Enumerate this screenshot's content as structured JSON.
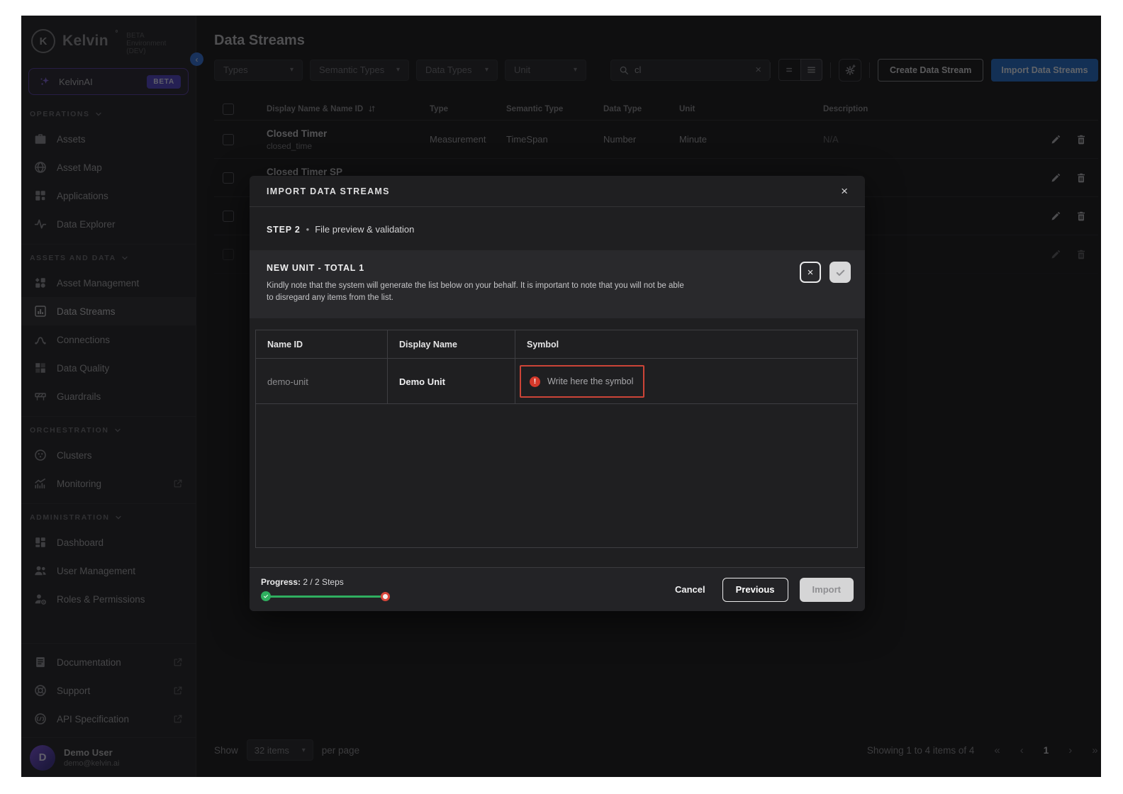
{
  "colors": {
    "accent_blue": "#1f6ac9",
    "accent_purple": "#53399f",
    "success_green": "#2fae5f",
    "error_red": "#cc4437"
  },
  "brand": {
    "name": "Kelvin",
    "env": "BETA Environment (DEV)",
    "logo_letter": "K"
  },
  "sidebar": {
    "ai": {
      "label": "KelvinAI",
      "badge": "BETA",
      "icon": "sparkle-icon"
    },
    "sections": [
      {
        "label": "OPERATIONS",
        "items": [
          {
            "label": "Assets",
            "icon": "briefcase-icon"
          },
          {
            "label": "Asset Map",
            "icon": "globe-icon"
          },
          {
            "label": "Applications",
            "icon": "apps-icon"
          },
          {
            "label": "Data Explorer",
            "icon": "pulse-icon"
          }
        ]
      },
      {
        "label": "ASSETS AND DATA",
        "items": [
          {
            "label": "Asset Management",
            "icon": "asset-management-icon"
          },
          {
            "label": "Data Streams",
            "icon": "bar-chart-icon",
            "active": true
          },
          {
            "label": "Connections",
            "icon": "connections-icon"
          },
          {
            "label": "Data Quality",
            "icon": "data-quality-icon"
          },
          {
            "label": "Guardrails",
            "icon": "guardrail-icon"
          }
        ]
      },
      {
        "label": "ORCHESTRATION",
        "items": [
          {
            "label": "Clusters",
            "icon": "cluster-icon"
          },
          {
            "label": "Monitoring",
            "icon": "monitoring-icon",
            "external": true
          }
        ]
      },
      {
        "label": "ADMINISTRATION",
        "items": [
          {
            "label": "Dashboard",
            "icon": "dashboard-icon"
          },
          {
            "label": "User Management",
            "icon": "users-icon"
          },
          {
            "label": "Roles & Permissions",
            "icon": "roles-icon"
          }
        ]
      }
    ],
    "bottom_items": [
      {
        "label": "Documentation",
        "icon": "document-icon",
        "external": true
      },
      {
        "label": "Support",
        "icon": "support-icon",
        "external": true
      },
      {
        "label": "API Specification",
        "icon": "api-icon",
        "external": true
      }
    ],
    "user": {
      "initial": "D",
      "name": "Demo User",
      "email": "demo@kelvin.ai"
    }
  },
  "page": {
    "title": "Data Streams",
    "filters": [
      {
        "label": "Types"
      },
      {
        "label": "Semantic Types"
      },
      {
        "label": "Data Types"
      },
      {
        "label": "Unit"
      }
    ],
    "search": {
      "value": "cl"
    },
    "create_button": "Create Data Stream",
    "import_button": "Import Data Streams"
  },
  "table": {
    "columns": [
      "Display Name & Name ID",
      "Type",
      "Semantic Type",
      "Data Type",
      "Unit",
      "Description"
    ],
    "rows": [
      {
        "display_name": "Closed Timer",
        "name_id": "closed_time",
        "type": "Measurement",
        "semantic_type": "TimeSpan",
        "data_type": "Number",
        "unit": "Minute",
        "description": "N/A",
        "dimmed": false
      },
      {
        "display_name": "Closed Timer SP",
        "name_id": "",
        "type": "",
        "semantic_type": "",
        "data_type": "",
        "unit": "",
        "description": "",
        "dimmed": false
      },
      {
        "display_name": "",
        "name_id": "",
        "type": "",
        "semantic_type": "",
        "data_type": "",
        "unit": "",
        "description": "",
        "dimmed": false
      },
      {
        "display_name": "",
        "name_id": "",
        "type": "",
        "semantic_type": "",
        "data_type": "",
        "unit": "",
        "description": "",
        "dimmed": true
      }
    ]
  },
  "pagination": {
    "show_label": "Show",
    "page_size": "32 items",
    "per_page_label": "per page",
    "summary": "Showing 1 to 4 items of 4",
    "current_page": "1"
  },
  "modal": {
    "title": "IMPORT DATA STREAMS",
    "step": {
      "label": "STEP 2",
      "text": "File preview & validation"
    },
    "notice": {
      "title": "NEW UNIT - TOTAL 1",
      "note": "Kindly note that the system will generate the list below on your behalf. It is important to note that you will not be able to disregard any items from the list."
    },
    "table": {
      "columns": [
        "Name ID",
        "Display Name",
        "Symbol"
      ],
      "row": {
        "name_id": "demo-unit",
        "display_name": "Demo Unit",
        "symbol_placeholder": "Write here the symbol"
      }
    },
    "footer": {
      "progress_label": "Progress:",
      "progress_value": "2 / 2 Steps",
      "cancel": "Cancel",
      "previous": "Previous",
      "import": "Import"
    }
  }
}
